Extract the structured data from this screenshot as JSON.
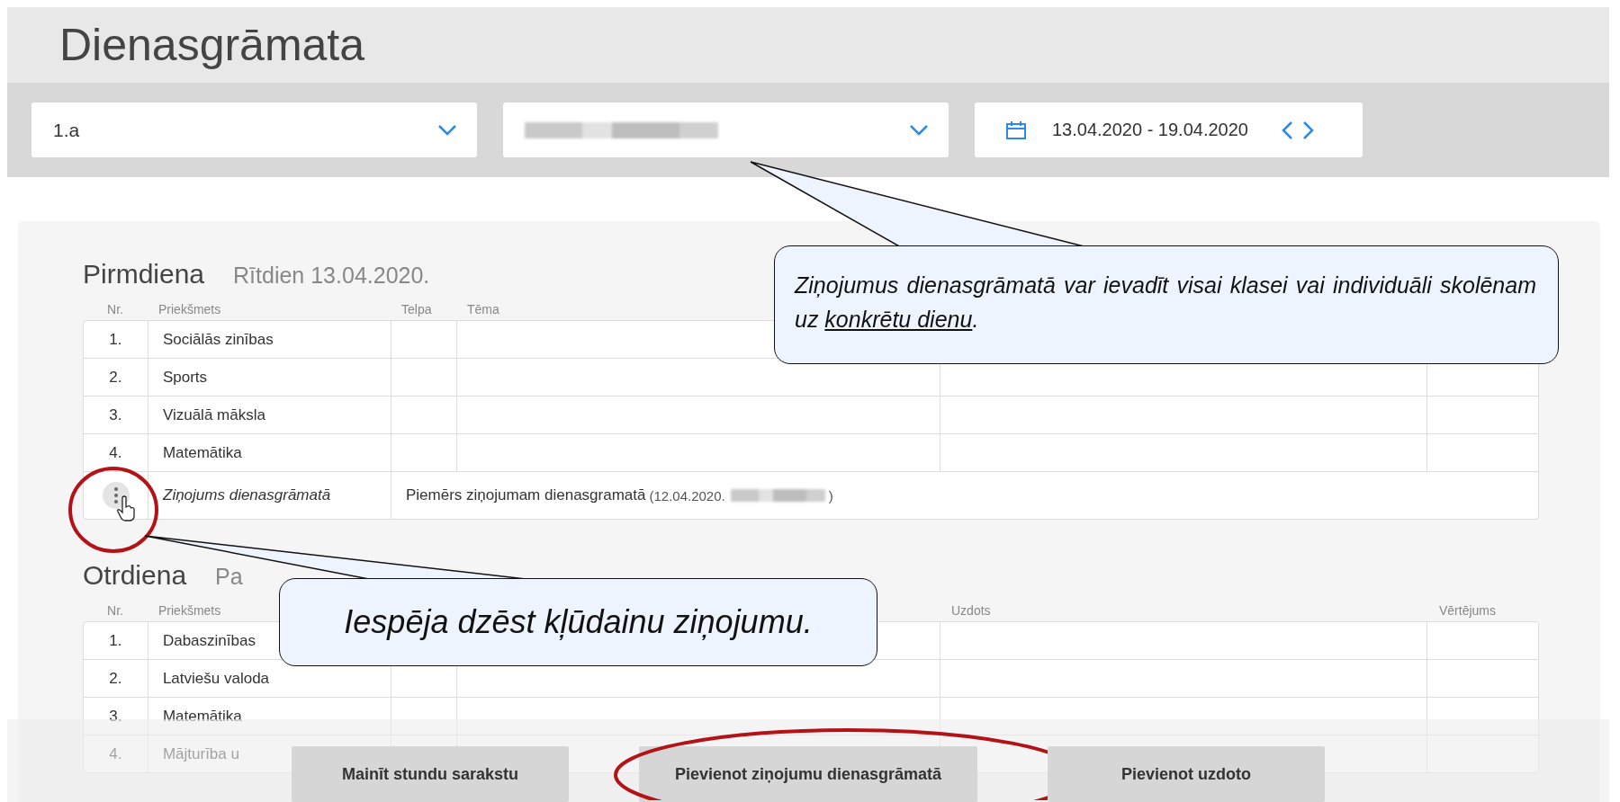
{
  "page_title": "Dienasgrāmata",
  "filters": {
    "class_value": "1.a",
    "week_range": "13.04.2020 - 19.04.2020"
  },
  "days": [
    {
      "name": "Pirmdiena",
      "subtitle": "Rītdien 13.04.2020.",
      "columns": {
        "nr": "Nr.",
        "subject": "Priekšmets",
        "room": "Telpa",
        "topic": "Tēma"
      },
      "rows": [
        {
          "kind": "lesson",
          "nr": "1.",
          "subject": "Sociālās zinības"
        },
        {
          "kind": "lesson",
          "nr": "2.",
          "subject": "Sports"
        },
        {
          "kind": "lesson",
          "nr": "3.",
          "subject": "Vizuālā māksla"
        },
        {
          "kind": "lesson",
          "nr": "4.",
          "subject": "Matemātika"
        },
        {
          "kind": "message",
          "subject": "Ziņojums dienasgrāmatā",
          "text": "Piemērs ziņojumam dienasgramatā",
          "date": "(12.04.2020.",
          "close": ")"
        }
      ]
    },
    {
      "name": "Otrdiena",
      "subtitle": "Pa",
      "columns": {
        "nr": "Nr.",
        "subject": "Priekšmets",
        "assigned": "Uzdots",
        "grade": "Vērtējums"
      },
      "rows": [
        {
          "kind": "lesson",
          "nr": "1.",
          "subject": "Dabaszinības"
        },
        {
          "kind": "lesson",
          "nr": "2.",
          "subject": "Latviešu valoda"
        },
        {
          "kind": "lesson",
          "nr": "3.",
          "subject": "Matemātika"
        },
        {
          "kind": "lesson",
          "nr": "4.",
          "subject": "Mājturība u"
        }
      ]
    }
  ],
  "callouts": [
    {
      "text": "Ziņojumus dienasgrāmatā var ievadīt visai klasei vai individuāli skolēnam uz ",
      "underlined": "konkrētu dienu",
      "end": "."
    },
    {
      "text": "Iespēja dzēst kļūdainu ziņojumu."
    }
  ],
  "buttons": [
    {
      "label": "Mainīt stundu sarakstu",
      "highlighted": false
    },
    {
      "label": "Pievienot ziņojumu dienasgrāmatā",
      "highlighted": true
    },
    {
      "label": "Pievienot uzdoto",
      "highlighted": false
    }
  ]
}
